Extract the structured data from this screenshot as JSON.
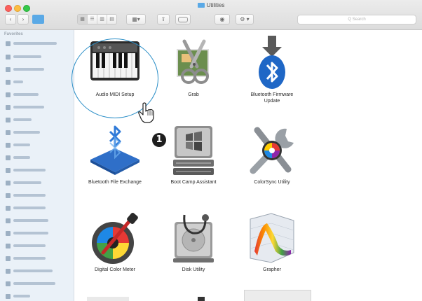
{
  "window": {
    "title": "Utilities"
  },
  "toolbar": {
    "back_label": "‹",
    "forward_label": "›",
    "view_icon": "⊞",
    "arrange_label": "▾",
    "share_label": "⇪",
    "tag_label": "",
    "quicklook_label": "◉",
    "action_label": "⚙ ▾"
  },
  "search": {
    "placeholder": "Q Search"
  },
  "sidebar": {
    "heading": "Favorites"
  },
  "badge": {
    "text": "1"
  },
  "items": [
    {
      "label": "Audio MIDI Setup",
      "icon": "piano-keyboard"
    },
    {
      "label": "Grab",
      "icon": "scissors"
    },
    {
      "label": "Bluetooth Firmware Update",
      "line1": "Bluetooth Firmware",
      "line2": "Update",
      "icon": "bluetooth-download"
    },
    {
      "label": "Bluetooth File Exchange",
      "icon": "bluetooth-exchange"
    },
    {
      "label": "Boot Camp Assistant",
      "icon": "hard-drive-windows"
    },
    {
      "label": "ColorSync Utility",
      "icon": "wrench-color"
    },
    {
      "label": "Digital Color Meter",
      "icon": "color-meter"
    },
    {
      "label": "Disk Utility",
      "icon": "stethoscope-drive"
    },
    {
      "label": "Grapher",
      "icon": "graph-surface"
    }
  ],
  "colors": {
    "accent": "#2a8ec7",
    "sidebar": "#eaf1f8"
  }
}
